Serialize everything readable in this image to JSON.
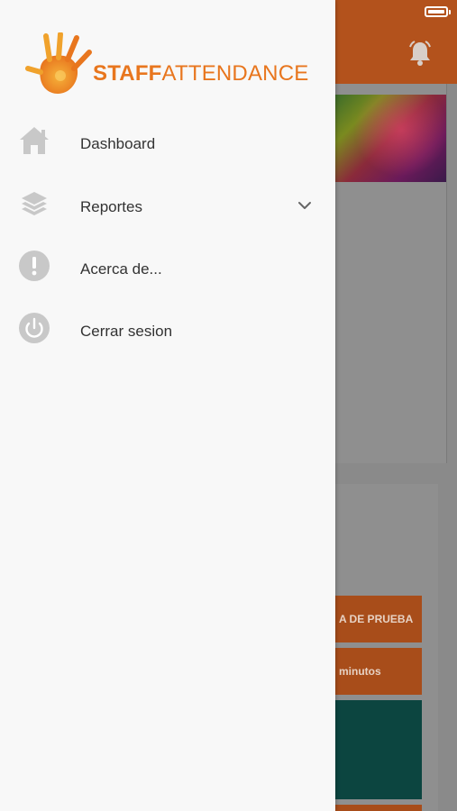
{
  "background": {
    "buttons": [
      {
        "label": "A DE PRUEBA"
      },
      {
        "label": "minutos"
      }
    ],
    "colors": {
      "header": "#b3521c",
      "button": "#a84d1a",
      "teal": "#0c4540"
    }
  },
  "drawer": {
    "logo": {
      "part1": "STAFF",
      "part2": "ATTENDANCE"
    },
    "items": [
      {
        "label": "Dashboard",
        "icon": "home-icon"
      },
      {
        "label": "Reportes",
        "icon": "layers-icon",
        "expandable": true
      },
      {
        "label": "Acerca de...",
        "icon": "info-icon"
      },
      {
        "label": "Cerrar sesion",
        "icon": "power-icon"
      }
    ],
    "colors": {
      "brand": "#e8761e",
      "icon": "#c8c8c8",
      "text": "#333333"
    }
  }
}
